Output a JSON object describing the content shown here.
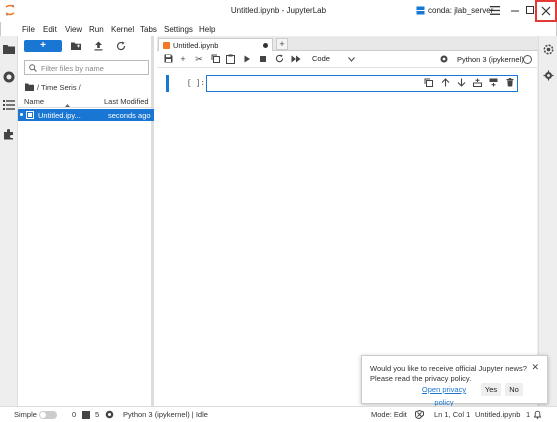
{
  "window": {
    "title": "Untitled.ipynb - JupyterLab",
    "env_label": "conda: jlab_server"
  },
  "menu": [
    "File",
    "Edit",
    "View",
    "Run",
    "Kernel",
    "Tabs",
    "Settings",
    "Help"
  ],
  "filebrowser": {
    "new_label": "+",
    "filter_placeholder": "Filter files by name",
    "path": "/ Time Seris /",
    "col_name": "Name",
    "col_modified": "Last Modified",
    "files": [
      {
        "name": "Untitled.ipy...",
        "modified": "seconds ago"
      }
    ]
  },
  "notebook": {
    "tab_label": "Untitled.ipynb",
    "cell_type": "Code",
    "kernel": "Python 3 (ipykernel)",
    "prompt": "[ ]:"
  },
  "statusbar": {
    "simple": "Simple",
    "terminals": "0",
    "kernels": "5",
    "kernel_status": "Python 3 (ipykernel) | Idle",
    "mode": "Mode: Edit",
    "position": "Ln 1, Col 1",
    "file": "Untitled.ipynb",
    "notifications": "1"
  },
  "toast": {
    "message": "Would you like to receive official Jupyter news? Please read the privacy policy.",
    "privacy_link": "Open privacy policy",
    "yes": "Yes",
    "no": "No"
  },
  "colors": {
    "accent": "#1976d2",
    "close_highlight": "#e53935",
    "jupyter_orange": "#f37726"
  }
}
